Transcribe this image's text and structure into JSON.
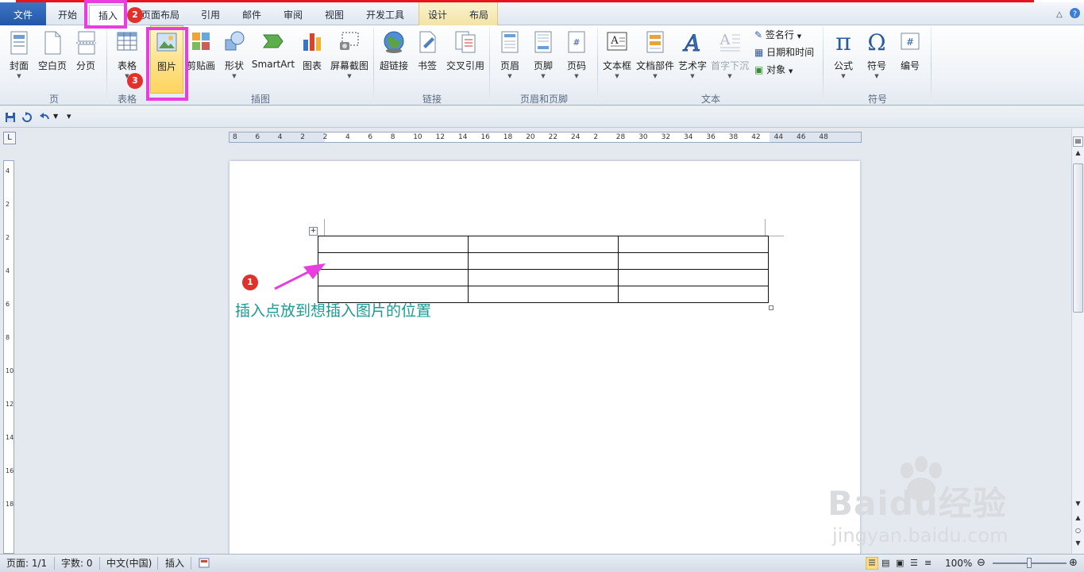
{
  "tabs": [
    {
      "id": "file",
      "label": "文件"
    },
    {
      "id": "home",
      "label": "开始"
    },
    {
      "id": "insert",
      "label": "插入"
    },
    {
      "id": "layout",
      "label": "页面布局"
    },
    {
      "id": "refs",
      "label": "引用"
    },
    {
      "id": "mail",
      "label": "邮件"
    },
    {
      "id": "review",
      "label": "审阅"
    },
    {
      "id": "view",
      "label": "视图"
    },
    {
      "id": "dev",
      "label": "开发工具"
    },
    {
      "id": "design",
      "label": "设计"
    },
    {
      "id": "tlayout",
      "label": "布局"
    }
  ],
  "ribbon": {
    "pages": {
      "cover": "封面",
      "blank": "空白页",
      "break": "分页",
      "group": "页"
    },
    "tables": {
      "table": "表格",
      "group": "表格"
    },
    "illus": {
      "picture": "图片",
      "clipart": "剪贴画",
      "shapes": "形状",
      "smartart": "SmartArt",
      "chart": "图表",
      "screenshot": "屏幕截图",
      "group": "插图"
    },
    "links": {
      "hyperlink": "超链接",
      "bookmark": "书签",
      "crossref": "交叉引用",
      "group": "链接"
    },
    "hf": {
      "header": "页眉",
      "footer": "页脚",
      "pagenum": "页码",
      "group": "页眉和页脚"
    },
    "text": {
      "textbox": "文本框",
      "parts": "文档部件",
      "wordart": "艺术字",
      "dropcap": "首字下沉",
      "sigline": "签名行",
      "datetime": "日期和时间",
      "object": "对象",
      "group": "文本"
    },
    "symbols": {
      "equation": "公式",
      "symbol": "符号",
      "number": "编号",
      "group": "符号"
    }
  },
  "ruler": {
    "h_ticks": [
      "8",
      "6",
      "4",
      "2",
      "2",
      "4",
      "6",
      "8",
      "10",
      "12",
      "14",
      "16",
      "18",
      "20",
      "22",
      "24",
      "2",
      "28",
      "30",
      "32",
      "34",
      "36",
      "38",
      "42",
      "44",
      "46",
      "48"
    ],
    "v_ticks": [
      "4",
      "2",
      "2",
      "4",
      "6",
      "8",
      "10",
      "12",
      "14",
      "16",
      "18"
    ]
  },
  "annotations": {
    "note": "插入点放到想插入图片的位置",
    "badge1": "1",
    "badge2": "2",
    "badge3": "3"
  },
  "status": {
    "page": "页面: 1/1",
    "words": "字数: 0",
    "lang": "中文(中国)",
    "mode": "插入",
    "zoom": "100%"
  },
  "watermark": {
    "brand": "Baidu经验",
    "url": "jingyan.baidu.com"
  },
  "colors": {
    "accent": "#2b5fae",
    "highlight": "#e83ee0",
    "note": "#1a9b93",
    "badge": "#e2302a"
  }
}
